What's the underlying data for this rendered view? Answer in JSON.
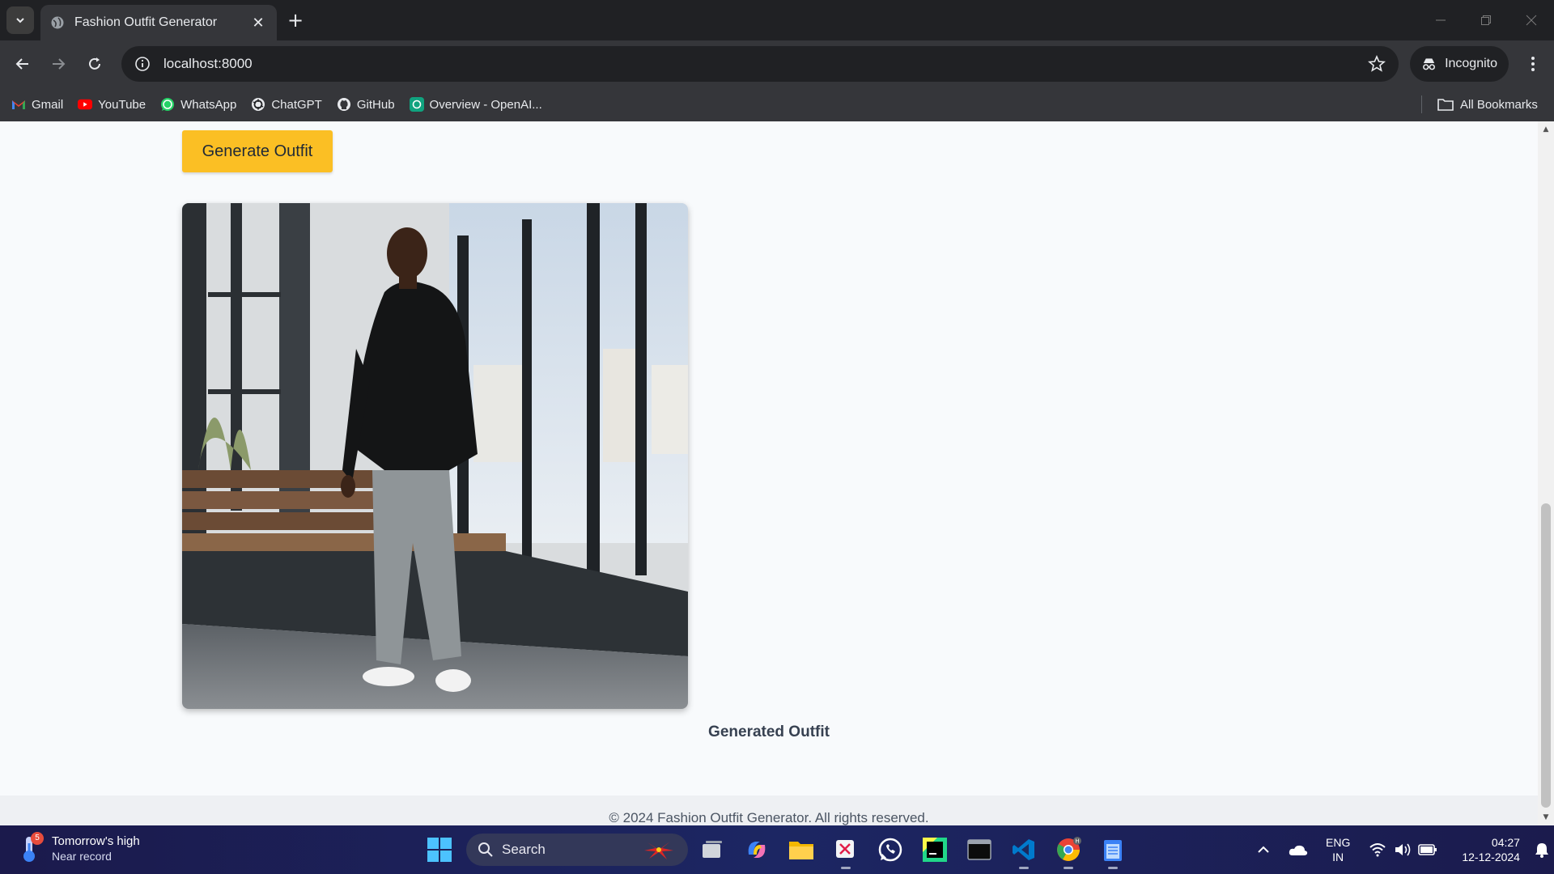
{
  "browser": {
    "tab_title": "Fashion Outfit Generator",
    "tab_close": "✕",
    "new_tab": "+",
    "url": "localhost:8000",
    "incognito_label": "Incognito",
    "bookmarks": [
      {
        "label": "Gmail",
        "icon": "gmail-icon"
      },
      {
        "label": "YouTube",
        "icon": "youtube-icon"
      },
      {
        "label": "WhatsApp",
        "icon": "whatsapp-icon"
      },
      {
        "label": "ChatGPT",
        "icon": "chatgpt-icon"
      },
      {
        "label": "GitHub",
        "icon": "github-icon"
      },
      {
        "label": "Overview - OpenAI...",
        "icon": "openai-icon"
      }
    ],
    "all_bookmarks": "All Bookmarks"
  },
  "page": {
    "generate_button": "Generate Outfit",
    "image_caption": "Generated Outfit",
    "footer": "© 2024 Fashion Outfit Generator. All rights reserved."
  },
  "taskbar": {
    "weather_badge": "5",
    "weather_title": "Tomorrow's high",
    "weather_subtitle": "Near record",
    "search_label": "Search",
    "language_line1": "ENG",
    "language_line2": "IN",
    "time": "04:27",
    "date": "12-12-2024"
  },
  "colors": {
    "accent_button": "#fbbf24",
    "page_background": "#f8fafc",
    "chrome_dark": "#202124",
    "chrome_mid": "#35363a"
  }
}
